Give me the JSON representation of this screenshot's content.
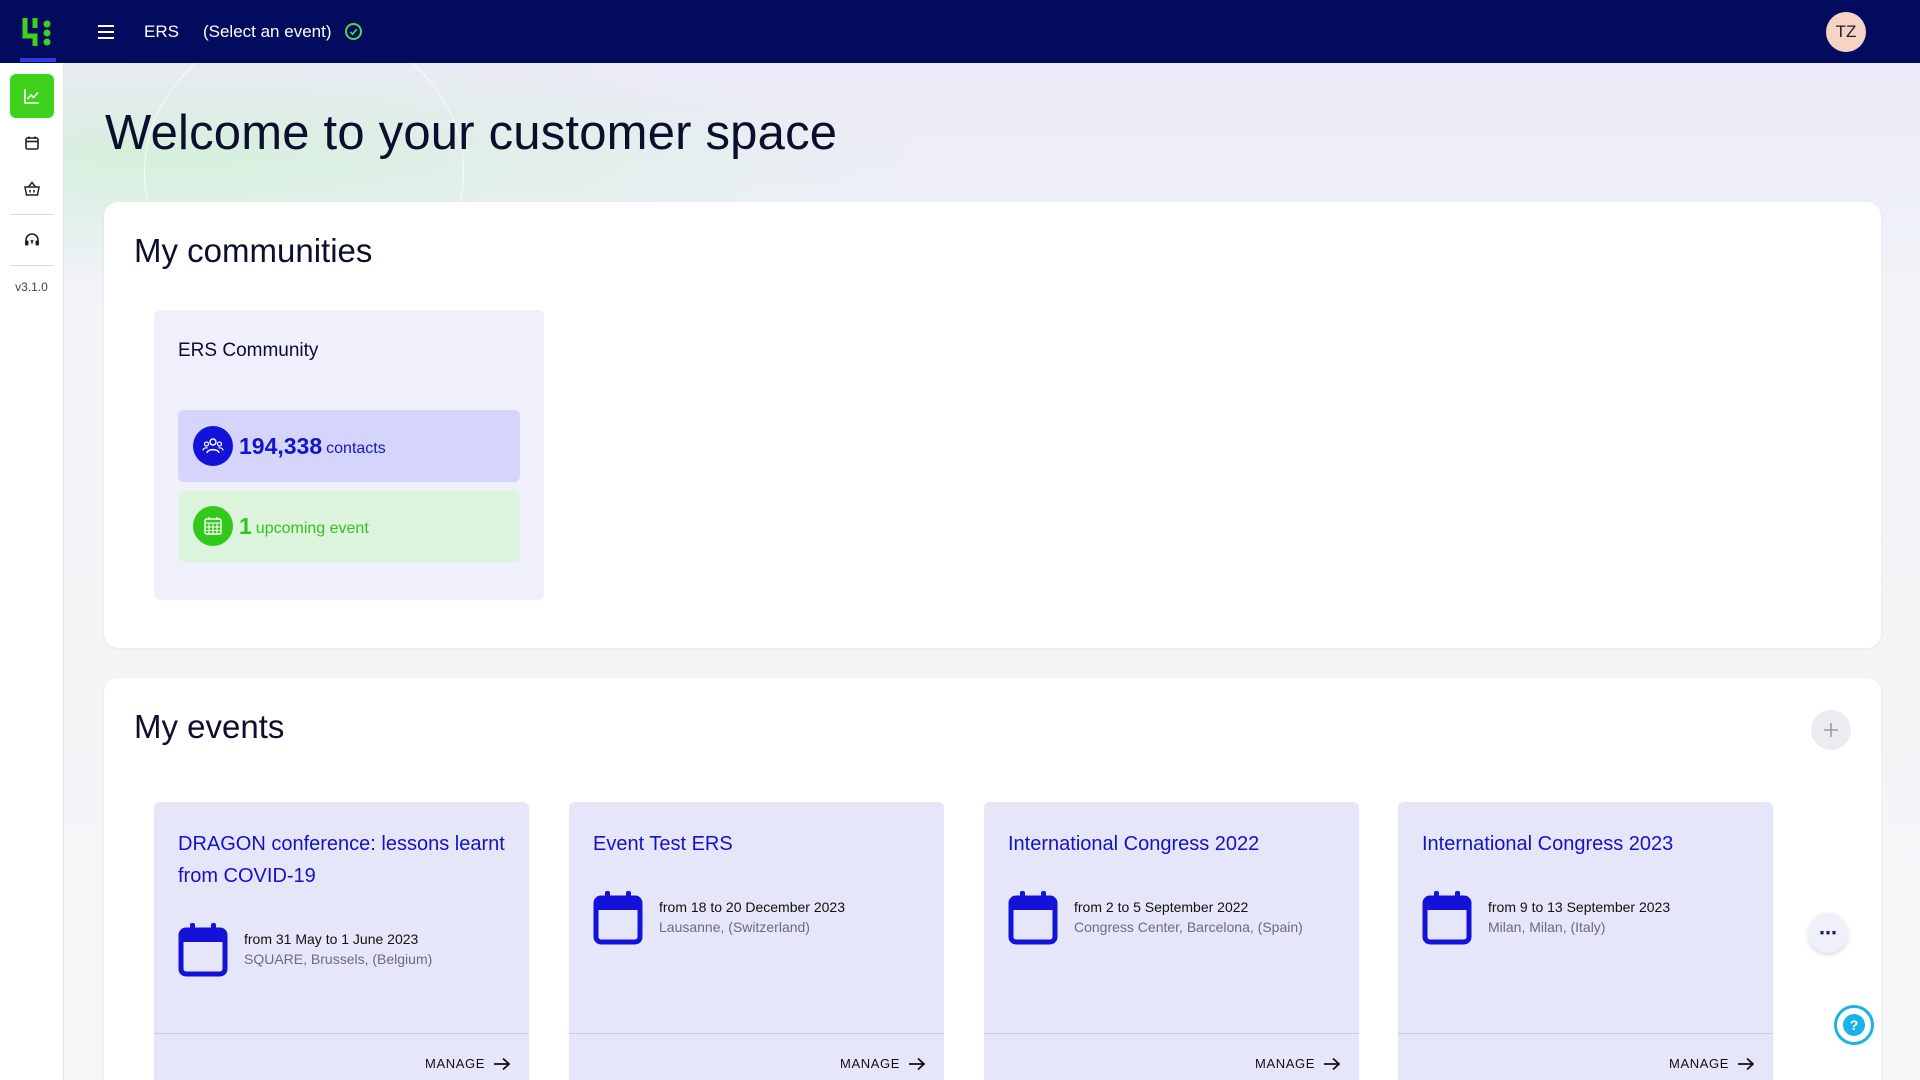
{
  "topbar": {
    "brand": "ERS",
    "event_selector": "(Select an event)",
    "avatar_initials": "TZ"
  },
  "sidebar": {
    "items": [
      {
        "icon": "chart-icon",
        "active": true
      },
      {
        "icon": "calendar-icon",
        "active": false
      },
      {
        "icon": "basket-icon",
        "active": false
      },
      {
        "icon": "support-headset-icon",
        "active": false
      }
    ],
    "version": "v3.1.0"
  },
  "hero": {
    "welcome_prefix": "Welcome to your",
    "welcome_bold": "customer space"
  },
  "communities": {
    "title": "My communities",
    "cards": [
      {
        "name": "ERS Community",
        "contacts_count": "194,338",
        "contacts_label": "contacts",
        "upcoming_count": "1",
        "upcoming_label": "upcoming event"
      }
    ]
  },
  "events": {
    "title": "My events",
    "manage_label": "MANAGE",
    "cards": [
      {
        "title": "DRAGON conference: lessons learnt from COVID-19",
        "dates": "from 31 May to 1 June 2023",
        "location": "SQUARE, Brussels, (Belgium)"
      },
      {
        "title": "Event Test ERS",
        "dates": "from 18 to 20 December 2023",
        "location": "Lausanne, (Switzerland)"
      },
      {
        "title": "International Congress 2022",
        "dates": "from 2 to 5 September 2022",
        "location": "Congress Center, Barcelona, (Spain)"
      },
      {
        "title": "International Congress 2023",
        "dates": "from 9 to 13 September 2023",
        "location": "Milan, Milan, (Italy)"
      }
    ]
  },
  "colors": {
    "topbar_bg": "#020b5e",
    "accent_green": "#3fd11c",
    "accent_blue": "#1212d8",
    "help_blue": "#1bb2e8"
  }
}
